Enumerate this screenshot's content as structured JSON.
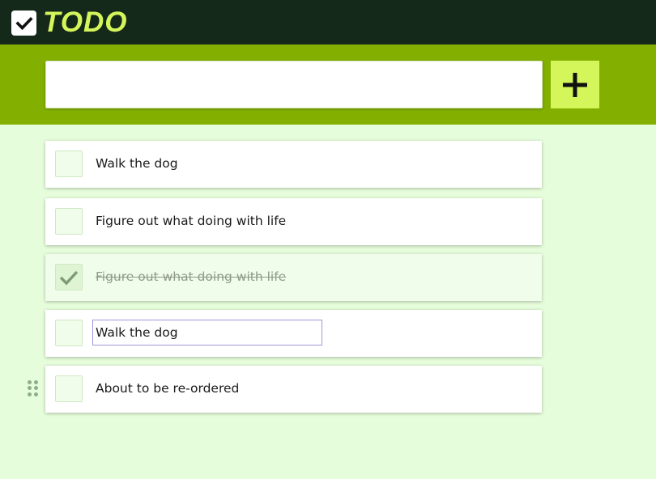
{
  "app": {
    "title": "TODO",
    "logo_icon": "checkbox-icon"
  },
  "add_bar": {
    "input_value": "",
    "input_placeholder": "",
    "add_icon": "plus-icon"
  },
  "todos": [
    {
      "label": "Walk the dog",
      "done": false
    },
    {
      "label": "Figure out what doing with life",
      "done": false
    },
    {
      "label": "Figure out what doing with life",
      "done": true
    },
    {
      "label": "Walk the dog",
      "done": false,
      "editing": true
    },
    {
      "label": "About to be re-ordered",
      "done": false
    }
  ],
  "colors": {
    "topbar": "#15291a",
    "accent": "#d4f65a",
    "addbar": "#83b000",
    "page": "#e6fddb"
  }
}
